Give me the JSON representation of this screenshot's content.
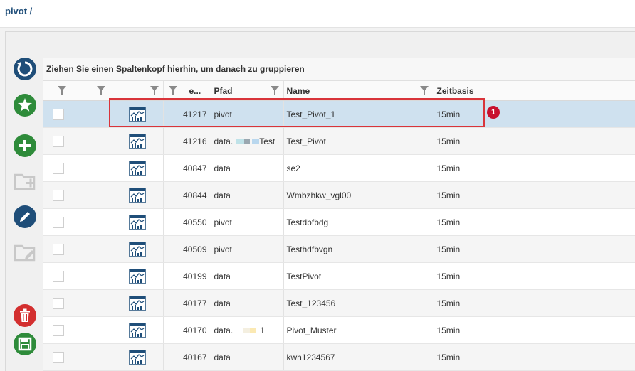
{
  "breadcrumb": "pivot /",
  "grid": {
    "group_hint": "Ziehen Sie einen Spaltenkopf hierhin, um danach zu gruppieren",
    "columns": {
      "id_label": "e...",
      "path_label": "Pfad",
      "name_label": "Name",
      "time_label": "Zeitbasis"
    },
    "rows": [
      {
        "id": "41217",
        "path": "pivot",
        "name": "Test_Pivot_1",
        "time": "15min"
      },
      {
        "id": "41216",
        "path": "data.",
        "path_suffix": "Test",
        "name": "Test_Pivot",
        "time": "15min"
      },
      {
        "id": "40847",
        "path": "data",
        "name": "se2",
        "time": "15min"
      },
      {
        "id": "40844",
        "path": "data",
        "name": "Wmbzhkw_vgl00",
        "time": "15min"
      },
      {
        "id": "40550",
        "path": "pivot",
        "name": "Testdbfbdg",
        "time": "15min"
      },
      {
        "id": "40509",
        "path": "pivot",
        "name": "Testhdfbvgn",
        "time": "15min"
      },
      {
        "id": "40199",
        "path": "data",
        "name": "TestPivot",
        "time": "15min"
      },
      {
        "id": "40177",
        "path": "data",
        "name": "Test_123456",
        "time": "15min"
      },
      {
        "id": "40170",
        "path": "data.",
        "path_suffix": "1",
        "name": "Pivot_Muster",
        "time": "15min"
      },
      {
        "id": "40167",
        "path": "data",
        "name": "kwh1234567",
        "time": "15min"
      }
    ]
  },
  "annotation": {
    "badge": "1"
  },
  "colors": {
    "accent": "#1f4e79",
    "selected_row": "#cfe1ef",
    "highlight": "#d9343a",
    "add": "#2e8b3a",
    "delete": "#d32f2f"
  }
}
